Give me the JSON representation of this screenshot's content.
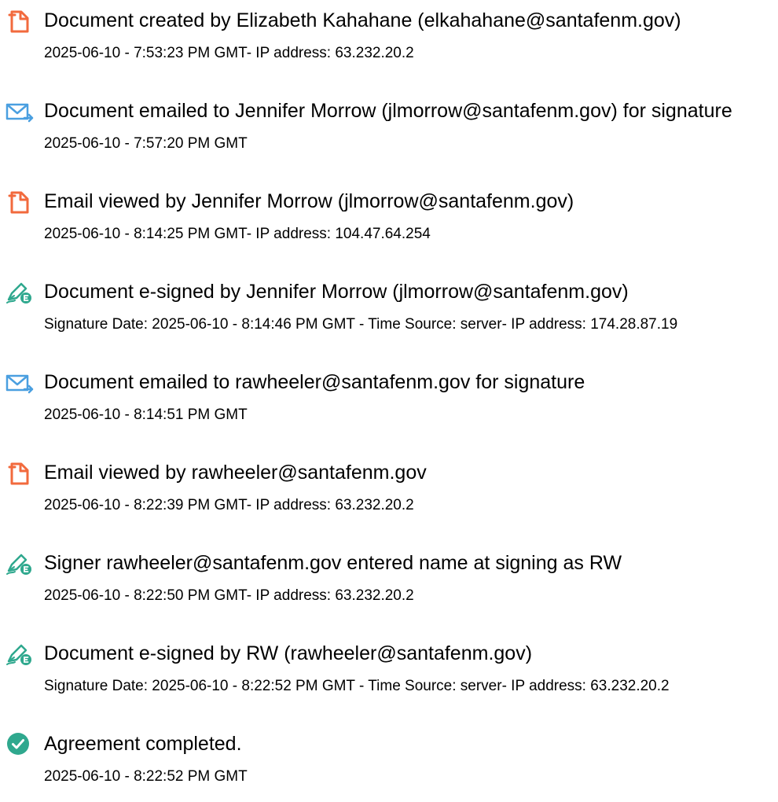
{
  "events": [
    {
      "icon": "document-icon",
      "title": "Document created by Elizabeth Kahahane (elkahahane@santafenm.gov)",
      "detail": "2025-06-10 - 7:53:23 PM GMT- IP address: 63.232.20.2"
    },
    {
      "icon": "email-sent-icon",
      "title": "Document emailed to Jennifer Morrow (jlmorrow@santafenm.gov) for signature",
      "detail": "2025-06-10 - 7:57:20 PM GMT"
    },
    {
      "icon": "document-icon",
      "title": "Email viewed by Jennifer Morrow (jlmorrow@santafenm.gov)",
      "detail": "2025-06-10 - 8:14:25 PM GMT- IP address: 104.47.64.254"
    },
    {
      "icon": "e-sign-pen-icon",
      "title": "Document e-signed by Jennifer Morrow (jlmorrow@santafenm.gov)",
      "detail": "Signature Date: 2025-06-10 - 8:14:46 PM GMT - Time Source: server- IP address: 174.28.87.19"
    },
    {
      "icon": "email-sent-icon",
      "title": "Document emailed to rawheeler@santafenm.gov for signature",
      "detail": "2025-06-10 - 8:14:51 PM GMT"
    },
    {
      "icon": "document-icon",
      "title": "Email viewed by rawheeler@santafenm.gov",
      "detail": "2025-06-10 - 8:22:39 PM GMT- IP address: 63.232.20.2"
    },
    {
      "icon": "e-sign-pen-icon",
      "title": "Signer rawheeler@santafenm.gov entered name at signing as RW",
      "detail": "2025-06-10 - 8:22:50 PM GMT- IP address: 63.232.20.2"
    },
    {
      "icon": "e-sign-pen-icon",
      "title": "Document e-signed by RW (rawheeler@santafenm.gov)",
      "detail": "Signature Date: 2025-06-10 - 8:22:52 PM GMT - Time Source: server- IP address: 63.232.20.2"
    },
    {
      "icon": "check-circle-icon",
      "title": "Agreement completed.",
      "detail": "2025-06-10 - 8:22:52 PM GMT"
    }
  ],
  "colors": {
    "document_icon": "#f26a3d",
    "email_icon": "#4a9fe0",
    "esign_icon": "#2fa88e",
    "check_icon": "#2fa88e",
    "text": "#000000"
  }
}
